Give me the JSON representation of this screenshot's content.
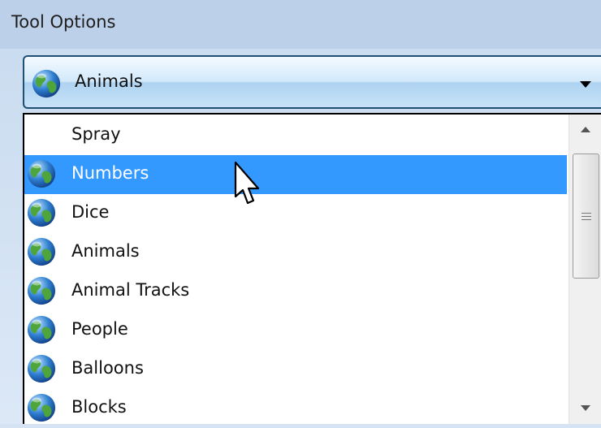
{
  "panel": {
    "title": "Tool Options"
  },
  "combo": {
    "selected": "Animals",
    "icon": "globe-icon"
  },
  "dropdown": {
    "items": [
      {
        "label": "Spray",
        "icon": ""
      },
      {
        "label": "Numbers",
        "icon": "globe-icon",
        "selected": true
      },
      {
        "label": "Dice",
        "icon": "globe-icon"
      },
      {
        "label": "Animals",
        "icon": "globe-icon"
      },
      {
        "label": "Animal Tracks",
        "icon": "globe-icon"
      },
      {
        "label": "People",
        "icon": "globe-icon"
      },
      {
        "label": "Balloons",
        "icon": "globe-icon"
      },
      {
        "label": "Blocks",
        "icon": "globe-icon"
      }
    ]
  },
  "colors": {
    "header": "#bcd0ea",
    "selection": "#3399ff",
    "combo_border": "#1f4f72"
  }
}
